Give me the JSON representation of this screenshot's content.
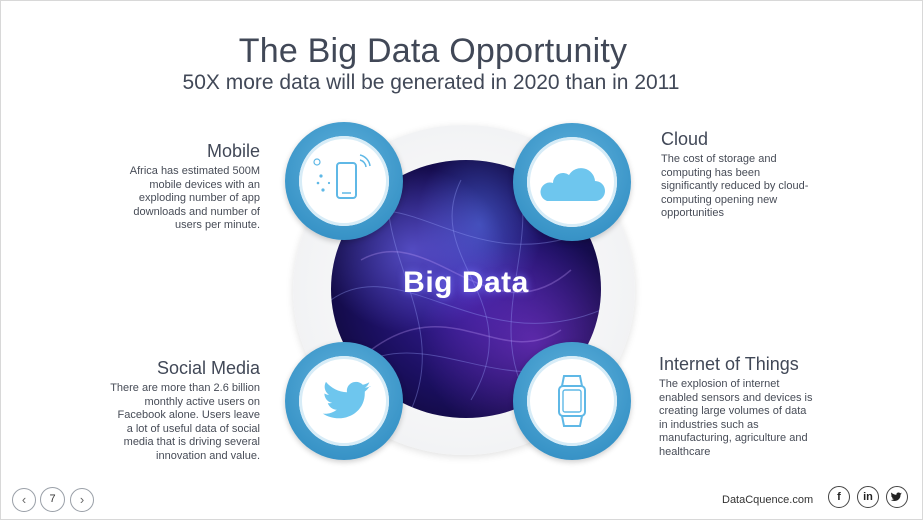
{
  "slide": {
    "title": "The Big Data Opportunity",
    "subtitle": "50X more data will be generated in 2020 than in 2011",
    "center_label": "Big Data"
  },
  "sections": {
    "mobile": {
      "heading": "Mobile",
      "text": "Africa has estimated 500M mobile devices with an exploding number of app downloads and number of users per minute.",
      "icon": "smartphone-icon"
    },
    "cloud": {
      "heading": "Cloud",
      "text": "The cost of storage and computing has been significantly reduced by cloud-computing opening new opportunities",
      "icon": "cloud-icon"
    },
    "social": {
      "heading": "Social Media",
      "text": "There are more than 2.6 billion monthly active users on Facebook alone. Users leave a lot of useful data of social media that is driving several innovation and value.",
      "icon": "twitter-bird-icon"
    },
    "iot": {
      "heading": "Internet of Things",
      "text": "The explosion of internet enabled sensors and devices is creating large volumes of data in industries such as manufacturing, agriculture and healthcare",
      "icon": "smartwatch-icon"
    }
  },
  "footer": {
    "page_number": "7",
    "brand": "DataCquence.com",
    "social": {
      "facebook": "f",
      "linkedin": "in",
      "twitter": "twitter-icon"
    }
  },
  "colors": {
    "accent": "#3a95c8",
    "icon_fill": "#6ec6ee",
    "text": "#414857"
  }
}
